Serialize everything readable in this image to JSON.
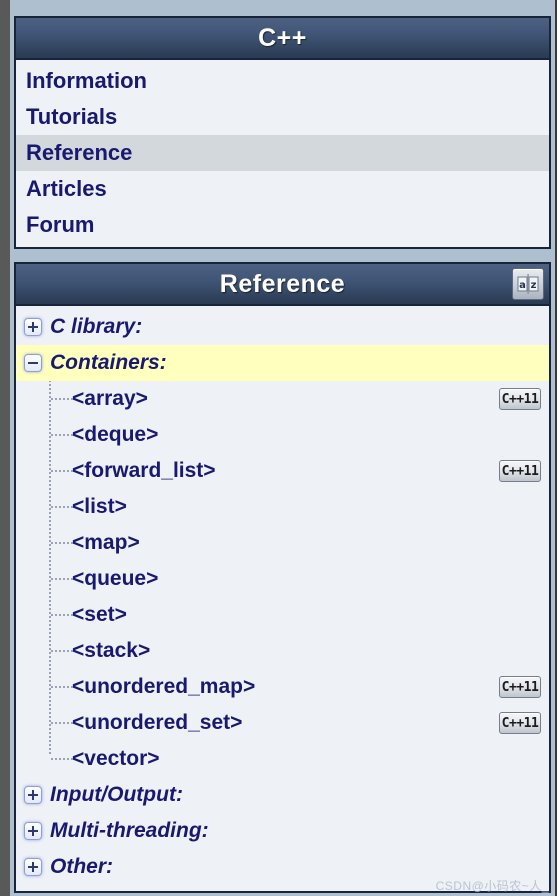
{
  "colors": {
    "page_background": "#aebfd0",
    "panel_background": "#eef1f6",
    "panel_border": "#18243a",
    "header_gradient_top": "#4d6182",
    "header_gradient_bottom": "#2b3b53",
    "link_text": "#191970",
    "nav_active_background": "#d3d8dd",
    "tree_highlight_background": "#ffffbe",
    "badge_text": "#1b1b1b"
  },
  "nav_panel": {
    "header": {
      "title": "C++"
    },
    "items": [
      {
        "label": "Information",
        "active": false
      },
      {
        "label": "Tutorials",
        "active": false
      },
      {
        "label": "Reference",
        "active": true
      },
      {
        "label": "Articles",
        "active": false
      },
      {
        "label": "Forum",
        "active": false
      }
    ]
  },
  "reference_panel": {
    "header": {
      "title": "Reference",
      "sort_button_icon": "a-z-sort-icon",
      "sort_button_label": "a|z"
    },
    "tree": [
      {
        "type": "category",
        "label": "C library:",
        "expanded": false,
        "highlight": false
      },
      {
        "type": "category",
        "label": "Containers:",
        "expanded": true,
        "highlight": true
      },
      {
        "type": "leaf",
        "label": "<array>",
        "badge": "C++11"
      },
      {
        "type": "leaf",
        "label": "<deque>",
        "badge": ""
      },
      {
        "type": "leaf",
        "label": "<forward_list>",
        "badge": "C++11"
      },
      {
        "type": "leaf",
        "label": "<list>",
        "badge": ""
      },
      {
        "type": "leaf",
        "label": "<map>",
        "badge": ""
      },
      {
        "type": "leaf",
        "label": "<queue>",
        "badge": ""
      },
      {
        "type": "leaf",
        "label": "<set>",
        "badge": ""
      },
      {
        "type": "leaf",
        "label": "<stack>",
        "badge": ""
      },
      {
        "type": "leaf",
        "label": "<unordered_map>",
        "badge": "C++11"
      },
      {
        "type": "leaf",
        "label": "<unordered_set>",
        "badge": "C++11"
      },
      {
        "type": "leaf",
        "label": "<vector>",
        "badge": ""
      },
      {
        "type": "category",
        "label": "Input/Output:",
        "expanded": false,
        "highlight": false
      },
      {
        "type": "category",
        "label": "Multi-threading:",
        "expanded": false,
        "highlight": false
      },
      {
        "type": "category",
        "label": "Other:",
        "expanded": false,
        "highlight": false
      }
    ]
  },
  "watermark": {
    "text": "CSDN@小码农~人_"
  }
}
